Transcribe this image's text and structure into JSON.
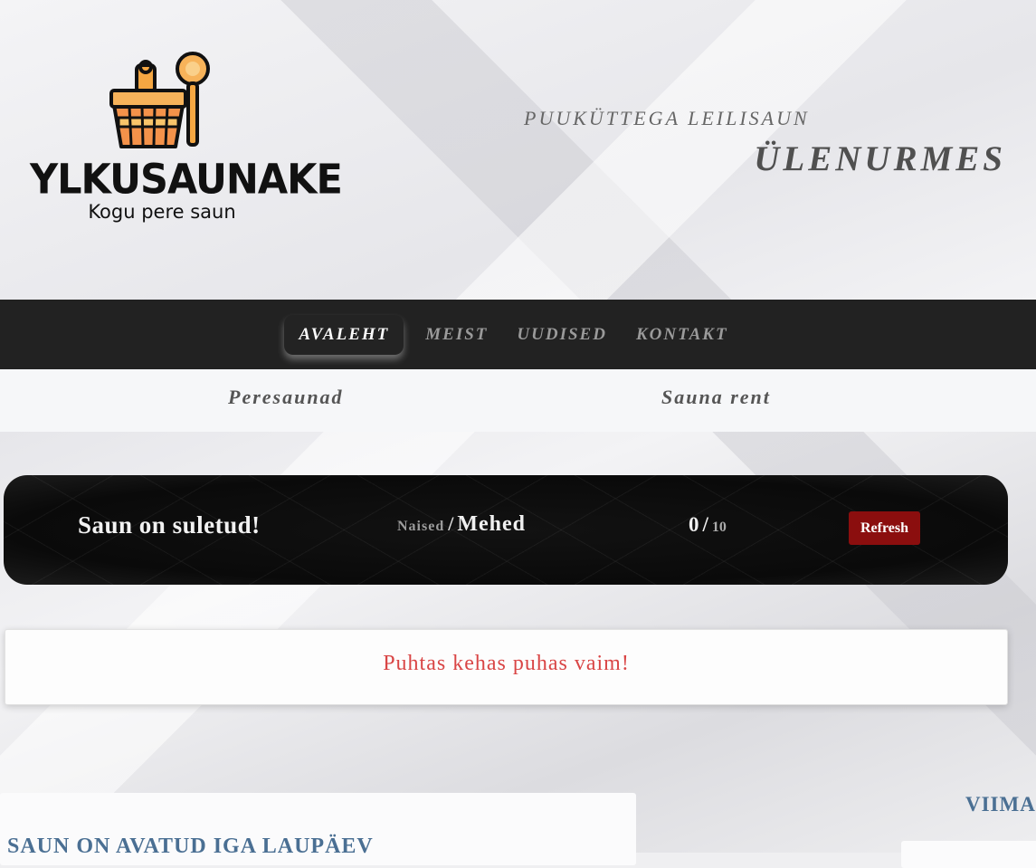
{
  "header": {
    "logo_title": "YLKUSAUNAKE",
    "logo_subtitle": "Kogu pere saun",
    "tagline": "PUUKÜTTEGA LEILISAUN",
    "location": "ÜLENURMES"
  },
  "nav": {
    "items": [
      {
        "label": "AVALEHT",
        "active": true
      },
      {
        "label": "MEIST",
        "active": false
      },
      {
        "label": "UUDISED",
        "active": false
      },
      {
        "label": "KONTAKT",
        "active": false
      }
    ]
  },
  "subnav": {
    "items": [
      {
        "label": "Peresaunad"
      },
      {
        "label": "Sauna rent"
      }
    ]
  },
  "status": {
    "message": "Saun on suletud!",
    "gender_women": "Naised",
    "gender_separator": "/",
    "gender_men": "Mehed",
    "count_current": "0",
    "count_separator": "/",
    "count_max": "10",
    "refresh_label": "Refresh",
    "refresh_color": "#8b0e0e"
  },
  "motto": {
    "text": "Puhtas kehas puhas vaim!",
    "color": "#d94545"
  },
  "bottom": {
    "left_title": "SAUN ON AVATUD IGA LAUPÄEV",
    "right_title": "VIIMA"
  },
  "colors": {
    "nav_bg": "#222222",
    "accent_blue": "#4a6f93"
  }
}
